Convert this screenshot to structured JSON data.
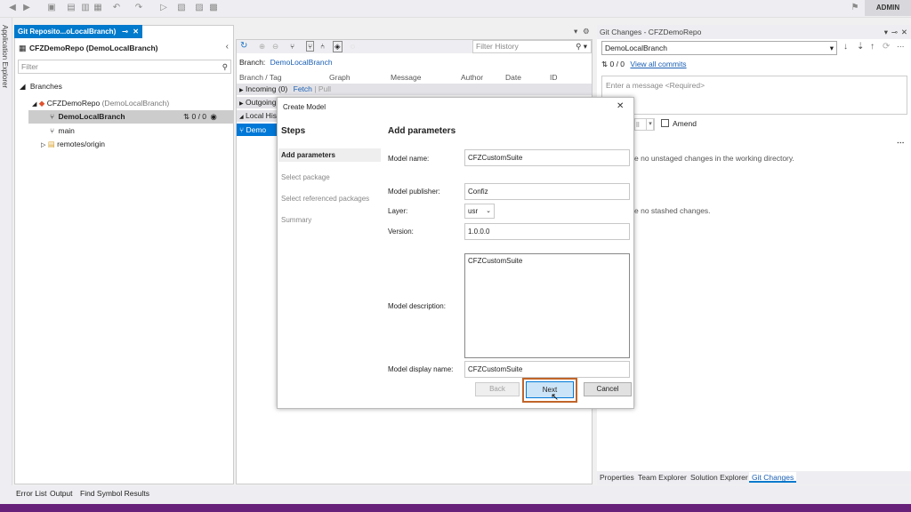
{
  "toolbar": {
    "account": "ADMIN"
  },
  "side_tab": {
    "label": "Application Explorer"
  },
  "left_pane": {
    "tab_title": "Git Reposito...oLocalBranch)",
    "repo_title": "CFZDemoRepo (DemoLocalBranch)",
    "filter_placeholder": "Filter",
    "branches_label": "Branches",
    "repo_node": "CFZDemoRepo",
    "repo_node_suffix": "(DemoLocalBranch)",
    "selected_branch": "DemoLocalBranch",
    "selected_branch_counts": "0 / 0",
    "branch_main": "main",
    "remotes": "remotes/origin"
  },
  "history_pane": {
    "filter_placeholder": "Filter History",
    "branch_label": "Branch:",
    "branch_value": "DemoLocalBranch",
    "columns": [
      "Branch / Tag",
      "Graph",
      "Message",
      "Author",
      "Date",
      "ID"
    ],
    "incoming": "Incoming (0)",
    "fetch": "Fetch",
    "pull": "Pull",
    "outgoing": "Outgoing",
    "local_history": "Local Hist",
    "local_item": "Demo"
  },
  "git_changes": {
    "title": "Git Changes - CFZDemoRepo",
    "branch": "DemoLocalBranch",
    "counts": "0 / 0",
    "view_all": "View all commits",
    "message_placeholder": "Enter a message <Required>",
    "commit_fragment": "ll",
    "amend": "Amend",
    "unstaged_msg": "e no unstaged changes in the working directory.",
    "stashed_msg": "e no stashed changes.",
    "tabs": [
      "Properties",
      "Team Explorer",
      "Solution Explorer",
      "Git Changes"
    ]
  },
  "dialog": {
    "title": "Create Model",
    "steps_heading": "Steps",
    "steps": [
      "Add parameters",
      "Select package",
      "Select referenced packages",
      "Summary"
    ],
    "section_heading": "Add parameters",
    "fields": {
      "model_name_label": "Model name:",
      "model_name": "CFZCustomSuite",
      "publisher_label": "Model publisher:",
      "publisher": "Confiz",
      "layer_label": "Layer:",
      "layer": "usr",
      "version_label": "Version:",
      "version": "1.0.0.0",
      "description_label": "Model description:",
      "description": "CFZCustomSuite",
      "display_name_label": "Model display name:",
      "display_name": "CFZCustomSuite"
    },
    "buttons": {
      "back": "Back",
      "next": "Next",
      "cancel": "Cancel"
    }
  },
  "bottom_tabs": [
    "Error List",
    "Output",
    "Find Symbol Results"
  ],
  "colors": {
    "accent": "#007acc",
    "status_bar": "#68217a",
    "highlight": "#c0652a"
  }
}
